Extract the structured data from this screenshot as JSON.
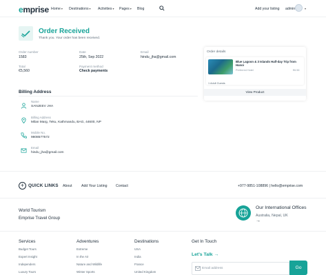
{
  "header": {
    "logo_prefix": "e",
    "logo_rest": "mprise",
    "nav": [
      {
        "label": "Home",
        "dropdown": true
      },
      {
        "label": "Destinations",
        "dropdown": true
      },
      {
        "label": "Activities",
        "dropdown": true
      },
      {
        "label": "Pages",
        "dropdown": true
      },
      {
        "label": "Blog",
        "dropdown": false
      }
    ],
    "add_listing": "Add your listing",
    "user": "admin"
  },
  "order": {
    "title": "Order Received",
    "subtitle": "Thank you. Your order has been received.",
    "order_number_label": "Order number",
    "order_number": "1583",
    "date_label": "Date",
    "date": "25th, Sep 2022",
    "email_label": "Email",
    "email": "hindu_jha@gmail.com",
    "total_label": "Total",
    "total": "€5,560",
    "payment_label": "Payment method",
    "payment": "Check payments"
  },
  "order_details": {
    "title": "Order details",
    "product_name": "Blue Lagoon & 3 Islands Half-day Trip from Hanoi",
    "product_sub": "Preferred Hotel",
    "product_price": "€6.56",
    "extra": "1 Adult Guests",
    "view_button": "View Product"
  },
  "billing": {
    "title": "Billing Address",
    "name_label": "Name",
    "name": "SANJEEV JHA",
    "address_label": "Billing Address",
    "address": "Milan Marg, Teku, Kathmandu, BAG, 44600, NP",
    "mobile_label": "Mobile No.",
    "mobile": "9808577572",
    "email_label": "Email",
    "email": "hindu_jha@gmail.com"
  },
  "quick_links": {
    "title": "QUICK LINKS",
    "links": [
      "About",
      "Add Your Listing",
      "Contact"
    ],
    "phone": "+977-9851-108896",
    "divider": "|",
    "email": "hello@emprise.com"
  },
  "footer": {
    "world_tourism": "World Tourism",
    "group": "Emprise Travel Group",
    "offices_title": "Our International Offices",
    "offices": "Australia, Nepal, UK",
    "columns": [
      {
        "heading": "Services",
        "items": [
          "Budget Tours",
          "Expert Insight",
          "Independers",
          "Luxury Tours"
        ]
      },
      {
        "heading": "Adventures",
        "items": [
          "Extreme",
          "In the Air",
          "Nature and Wildlife",
          "Winter Sports"
        ]
      },
      {
        "heading": "Destinations",
        "items": [
          "USA",
          "India",
          "France",
          "United Kingdom"
        ]
      }
    ],
    "get_in_touch": "Get In Touch",
    "lets_talk": "Let's Talk",
    "email_placeholder": "Email address",
    "go": "Go"
  },
  "colors": {
    "accent": "#17a398",
    "text": "#1f2d3a"
  }
}
